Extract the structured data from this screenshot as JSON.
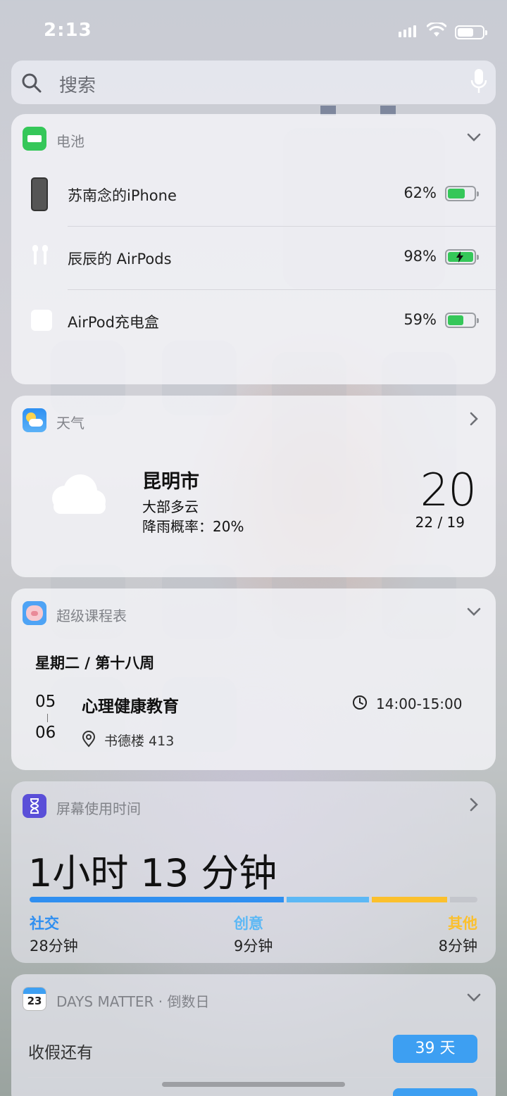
{
  "status_bar": {
    "time": "2:13"
  },
  "search": {
    "placeholder": "搜索"
  },
  "battery_widget": {
    "title": "电池",
    "devices": [
      {
        "name": "苏南念的iPhone",
        "percent": "62%",
        "level": 0.62,
        "charging": false
      },
      {
        "name": "辰辰的 AirPods",
        "percent": "98%",
        "level": 0.98,
        "charging": true
      },
      {
        "name": "AirPod充电盒",
        "percent": "59%",
        "level": 0.59,
        "charging": false
      }
    ]
  },
  "weather_widget": {
    "title": "天气",
    "city": "昆明市",
    "condition": "大部多云",
    "rain": "降雨概率：20%",
    "temperature": "20",
    "hi_lo": "22 / 19"
  },
  "schedule_widget": {
    "title": "超级课程表",
    "date_week": "星期二 / 第十八周",
    "period_start": "05",
    "period_end": "06",
    "course": "心理健康教育",
    "time": "14:00-15:00",
    "location": "书德楼 413"
  },
  "screentime_widget": {
    "title": "屏幕使用时间",
    "total": "1小时 13 分钟",
    "categories": [
      {
        "label": "社交",
        "value": "28分钟",
        "color": "#2f8ff0",
        "fraction": 0.574
      },
      {
        "label": "创意",
        "value": "9分钟",
        "color": "#5cb8f5",
        "fraction": 0.19
      },
      {
        "label": "其他",
        "value": "8分钟",
        "color": "#fbc02d",
        "fraction": 0.175
      }
    ],
    "remaining_color": "#c4c6cc"
  },
  "days_matter_widget": {
    "title": "DAYS MATTER · 倒数日",
    "icon_day": "23",
    "event": "收假还有",
    "badge": "39 天"
  },
  "colors": {
    "battery_green": "#35c759",
    "weather_blue": "#2e8ff2",
    "screentime_purple": "#5a4fd8",
    "days_blue": "#3d9ff2"
  }
}
